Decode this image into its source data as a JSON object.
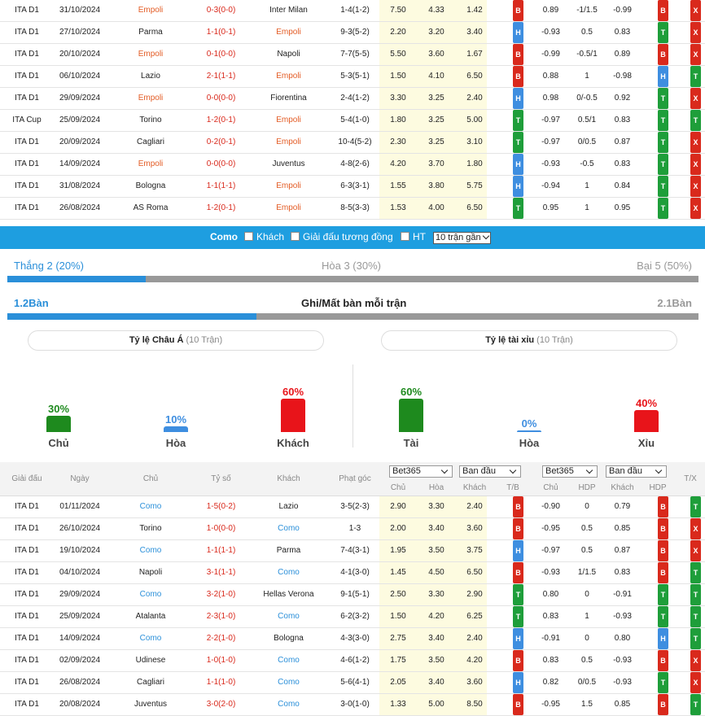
{
  "top_rows": [
    {
      "league": "ITA D1",
      "date": "31/10/2024",
      "home": "Empoli",
      "score": "0-3(0-0)",
      "away": "Inter Milan",
      "corner": "1-4(1-2)",
      "o1": "7.50",
      "o2": "4.33",
      "o3": "1.42",
      "tb": "B",
      "h1": "0.89",
      "h2": "-1/1.5",
      "h3": "-0.99",
      "r1": "B",
      "r2": "X",
      "emp": "home"
    },
    {
      "league": "ITA D1",
      "date": "27/10/2024",
      "home": "Parma",
      "score": "1-1(0-1)",
      "away": "Empoli",
      "corner": "9-3(5-2)",
      "o1": "2.20",
      "o2": "3.20",
      "o3": "3.40",
      "tb": "H",
      "h1": "-0.93",
      "h2": "0.5",
      "h3": "0.83",
      "r1": "T",
      "r2": "X",
      "emp": "away"
    },
    {
      "league": "ITA D1",
      "date": "20/10/2024",
      "home": "Empoli",
      "score": "0-1(0-0)",
      "away": "Napoli",
      "corner": "7-7(5-5)",
      "o1": "5.50",
      "o2": "3.60",
      "o3": "1.67",
      "tb": "B",
      "h1": "-0.99",
      "h2": "-0.5/1",
      "h3": "0.89",
      "r1": "B",
      "r2": "X",
      "emp": "home"
    },
    {
      "league": "ITA D1",
      "date": "06/10/2024",
      "home": "Lazio",
      "score": "2-1(1-1)",
      "away": "Empoli",
      "corner": "5-3(5-1)",
      "o1": "1.50",
      "o2": "4.10",
      "o3": "6.50",
      "tb": "B",
      "h1": "0.88",
      "h2": "1",
      "h3": "-0.98",
      "r1": "H",
      "r2": "T",
      "emp": "away"
    },
    {
      "league": "ITA D1",
      "date": "29/09/2024",
      "home": "Empoli",
      "score": "0-0(0-0)",
      "away": "Fiorentina",
      "corner": "2-4(1-2)",
      "o1": "3.30",
      "o2": "3.25",
      "o3": "2.40",
      "tb": "H",
      "h1": "0.98",
      "h2": "0/-0.5",
      "h3": "0.92",
      "r1": "T",
      "r2": "X",
      "emp": "home"
    },
    {
      "league": "ITA Cup",
      "date": "25/09/2024",
      "home": "Torino",
      "score": "1-2(0-1)",
      "away": "Empoli",
      "corner": "5-4(1-0)",
      "o1": "1.80",
      "o2": "3.25",
      "o3": "5.00",
      "tb": "T",
      "h1": "-0.97",
      "h2": "0.5/1",
      "h3": "0.83",
      "r1": "T",
      "r2": "T",
      "emp": "away"
    },
    {
      "league": "ITA D1",
      "date": "20/09/2024",
      "home": "Cagliari",
      "score": "0-2(0-1)",
      "away": "Empoli",
      "corner": "10-4(5-2)",
      "o1": "2.30",
      "o2": "3.25",
      "o3": "3.10",
      "tb": "T",
      "h1": "-0.97",
      "h2": "0/0.5",
      "h3": "0.87",
      "r1": "T",
      "r2": "X",
      "emp": "away"
    },
    {
      "league": "ITA D1",
      "date": "14/09/2024",
      "home": "Empoli",
      "score": "0-0(0-0)",
      "away": "Juventus",
      "corner": "4-8(2-6)",
      "o1": "4.20",
      "o2": "3.70",
      "o3": "1.80",
      "tb": "H",
      "h1": "-0.93",
      "h2": "-0.5",
      "h3": "0.83",
      "r1": "T",
      "r2": "X",
      "emp": "home"
    },
    {
      "league": "ITA D1",
      "date": "31/08/2024",
      "home": "Bologna",
      "score": "1-1(1-1)",
      "away": "Empoli",
      "corner": "6-3(3-1)",
      "o1": "1.55",
      "o2": "3.80",
      "o3": "5.75",
      "tb": "H",
      "h1": "-0.94",
      "h2": "1",
      "h3": "0.84",
      "r1": "T",
      "r2": "X",
      "emp": "away"
    },
    {
      "league": "ITA D1",
      "date": "26/08/2024",
      "home": "AS Roma",
      "score": "1-2(0-1)",
      "away": "Empoli",
      "corner": "8-5(3-3)",
      "o1": "1.53",
      "o2": "4.00",
      "o3": "6.50",
      "tb": "T",
      "h1": "0.95",
      "h2": "1",
      "h3": "0.95",
      "r1": "T",
      "r2": "X",
      "emp": "away"
    }
  ],
  "filter_bar": {
    "team": "Como",
    "away_label": "Khách",
    "same_league_label": "Giải đấu tương đồng",
    "ht_label": "HT",
    "recent_select": "10 trận gần"
  },
  "record": {
    "win": "Thắng 2 (20%)",
    "draw": "Hòa 3 (30%)",
    "loss": "Bại 5 (50%)",
    "win_fraction": 0.2
  },
  "goals": {
    "left": "1.2Bàn",
    "title": "Ghi/Mất bàn mỗi trận",
    "right": "2.1Bàn",
    "left_fraction": 0.36
  },
  "asian": {
    "title": "Tỷ lệ Châu Á",
    "count": "(10 Trận)",
    "items": [
      {
        "pct": "30%",
        "label": "Chủ",
        "value": 30,
        "color": "#1e8a1e"
      },
      {
        "pct": "10%",
        "label": "Hòa",
        "value": 10,
        "color": "#3e8ee0"
      },
      {
        "pct": "60%",
        "label": "Khách",
        "value": 60,
        "color": "#e8141a"
      }
    ]
  },
  "ou": {
    "title": "Tỷ lệ tài xỉu",
    "count": "(10 Trận)",
    "items": [
      {
        "pct": "60%",
        "label": "Tài",
        "value": 60,
        "color": "#1e8a1e"
      },
      {
        "pct": "0%",
        "label": "Hòa",
        "value": 0,
        "color": "#3e8ee0"
      },
      {
        "pct": "40%",
        "label": "Xỉu",
        "value": 40,
        "color": "#e8141a"
      }
    ]
  },
  "header": {
    "league": "Giải đấu",
    "date": "Ngày",
    "home": "Chủ",
    "score": "Tỷ số",
    "away": "Khách",
    "corner": "Phạt góc",
    "book1": "Bet365",
    "type1": "Ban đầu",
    "book2": "Bet365",
    "type2": "Ban đầu",
    "h_home": "Chủ",
    "h_draw": "Hòa",
    "h_away": "Khách",
    "h_tb": "T/B",
    "a_home": "Chủ",
    "a_hdp": "HDP",
    "a_away": "Khách",
    "a_hdp2": "HDP",
    "tx": "T/X"
  },
  "bottom_rows": [
    {
      "league": "ITA D1",
      "date": "01/11/2024",
      "home": "Como",
      "score": "1-5(0-2)",
      "away": "Lazio",
      "corner": "3-5(2-3)",
      "o1": "2.90",
      "o2": "3.30",
      "o3": "2.40",
      "tb": "B",
      "h1": "-0.90",
      "h2": "0",
      "h3": "0.79",
      "r1": "B",
      "r2": "T",
      "como": "home"
    },
    {
      "league": "ITA D1",
      "date": "26/10/2024",
      "home": "Torino",
      "score": "1-0(0-0)",
      "away": "Como",
      "corner": "1-3",
      "o1": "2.00",
      "o2": "3.40",
      "o3": "3.60",
      "tb": "B",
      "h1": "-0.95",
      "h2": "0.5",
      "h3": "0.85",
      "r1": "B",
      "r2": "X",
      "como": "away"
    },
    {
      "league": "ITA D1",
      "date": "19/10/2024",
      "home": "Como",
      "score": "1-1(1-1)",
      "away": "Parma",
      "corner": "7-4(3-1)",
      "o1": "1.95",
      "o2": "3.50",
      "o3": "3.75",
      "tb": "H",
      "h1": "-0.97",
      "h2": "0.5",
      "h3": "0.87",
      "r1": "B",
      "r2": "X",
      "como": "home"
    },
    {
      "league": "ITA D1",
      "date": "04/10/2024",
      "home": "Napoli",
      "score": "3-1(1-1)",
      "away": "Como",
      "corner": "4-1(3-0)",
      "o1": "1.45",
      "o2": "4.50",
      "o3": "6.50",
      "tb": "B",
      "h1": "-0.93",
      "h2": "1/1.5",
      "h3": "0.83",
      "r1": "B",
      "r2": "T",
      "como": "away"
    },
    {
      "league": "ITA D1",
      "date": "29/09/2024",
      "home": "Como",
      "score": "3-2(1-0)",
      "away": "Hellas Verona",
      "corner": "9-1(5-1)",
      "o1": "2.50",
      "o2": "3.30",
      "o3": "2.90",
      "tb": "T",
      "h1": "0.80",
      "h2": "0",
      "h3": "-0.91",
      "r1": "T",
      "r2": "T",
      "como": "home"
    },
    {
      "league": "ITA D1",
      "date": "25/09/2024",
      "home": "Atalanta",
      "score": "2-3(1-0)",
      "away": "Como",
      "corner": "6-2(3-2)",
      "o1": "1.50",
      "o2": "4.20",
      "o3": "6.25",
      "tb": "T",
      "h1": "0.83",
      "h2": "1",
      "h3": "-0.93",
      "r1": "T",
      "r2": "T",
      "como": "away"
    },
    {
      "league": "ITA D1",
      "date": "14/09/2024",
      "home": "Como",
      "score": "2-2(1-0)",
      "away": "Bologna",
      "corner": "4-3(3-0)",
      "o1": "2.75",
      "o2": "3.40",
      "o3": "2.40",
      "tb": "H",
      "h1": "-0.91",
      "h2": "0",
      "h3": "0.80",
      "r1": "H",
      "r2": "T",
      "como": "home"
    },
    {
      "league": "ITA D1",
      "date": "02/09/2024",
      "home": "Udinese",
      "score": "1-0(1-0)",
      "away": "Como",
      "corner": "4-6(1-2)",
      "o1": "1.75",
      "o2": "3.50",
      "o3": "4.20",
      "tb": "B",
      "h1": "0.83",
      "h2": "0.5",
      "h3": "-0.93",
      "r1": "B",
      "r2": "X",
      "como": "away"
    },
    {
      "league": "ITA D1",
      "date": "26/08/2024",
      "home": "Cagliari",
      "score": "1-1(1-0)",
      "away": "Como",
      "corner": "5-6(4-1)",
      "o1": "2.05",
      "o2": "3.40",
      "o3": "3.60",
      "tb": "H",
      "h1": "0.82",
      "h2": "0/0.5",
      "h3": "-0.93",
      "r1": "T",
      "r2": "X",
      "como": "away"
    },
    {
      "league": "ITA D1",
      "date": "20/08/2024",
      "home": "Juventus",
      "score": "3-0(2-0)",
      "away": "Como",
      "corner": "3-0(1-0)",
      "o1": "1.33",
      "o2": "5.00",
      "o3": "8.50",
      "tb": "B",
      "h1": "-0.95",
      "h2": "1.5",
      "h3": "0.85",
      "r1": "B",
      "r2": "T",
      "como": "away"
    }
  ]
}
